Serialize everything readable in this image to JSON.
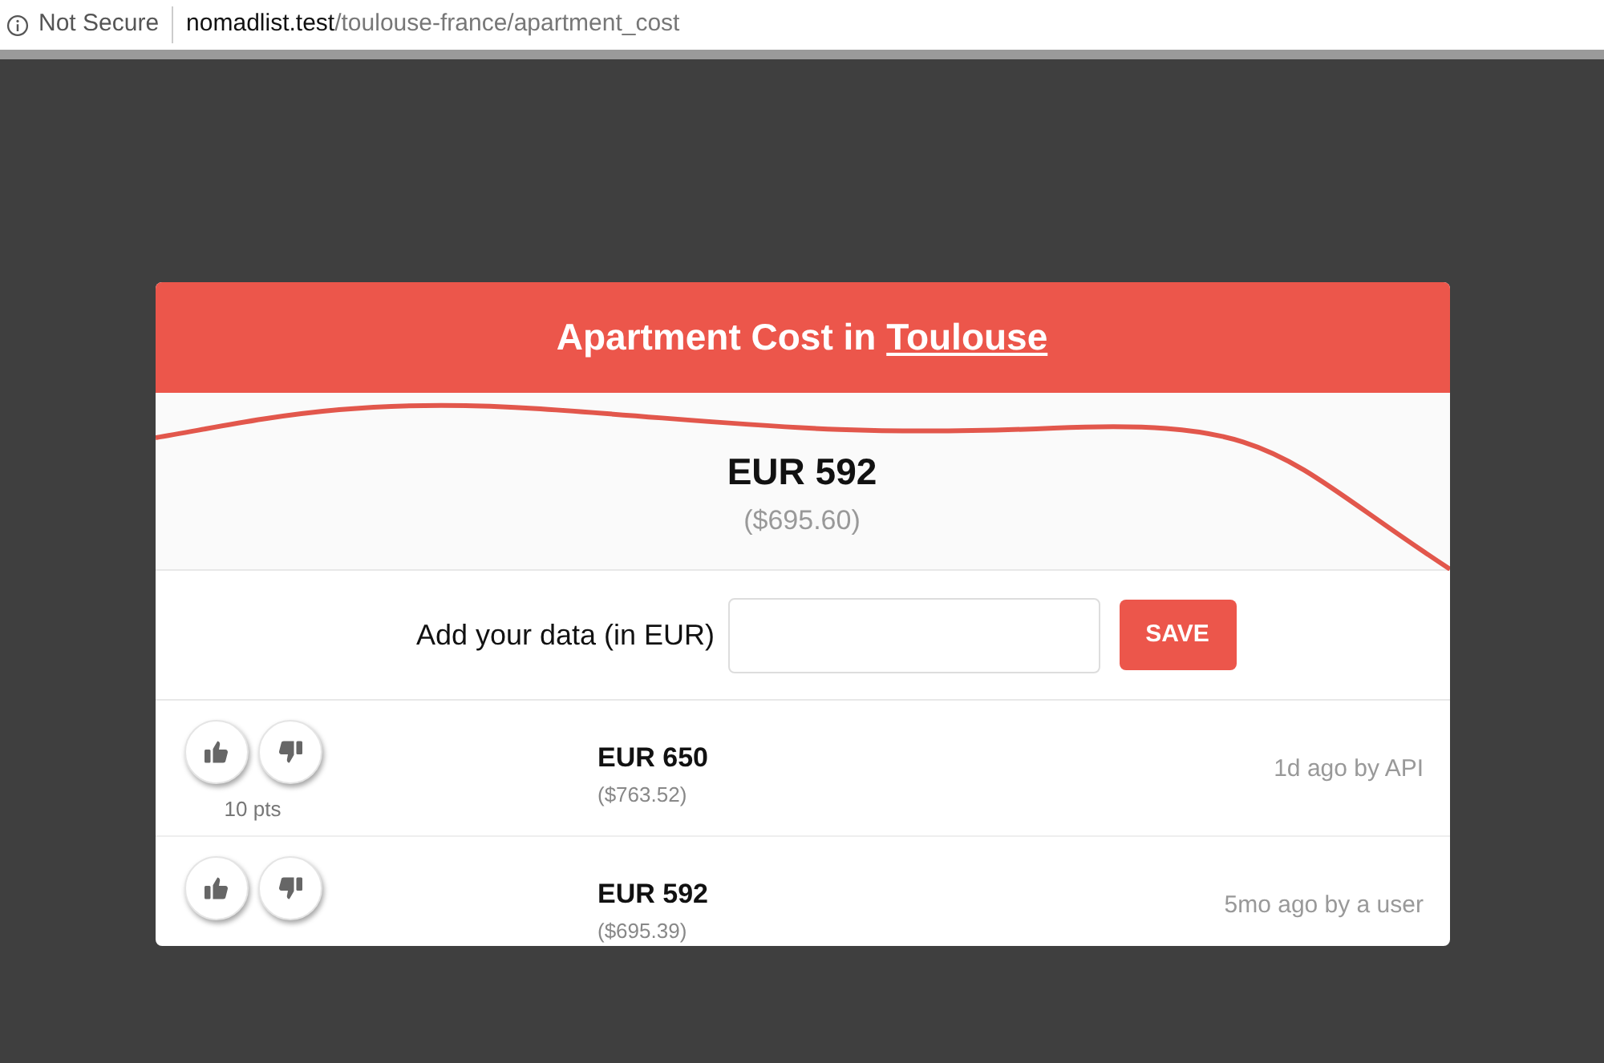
{
  "address_bar": {
    "security": "Not Secure",
    "domain": "nomadlist.test",
    "path": "/toulouse-france/apartment_cost"
  },
  "card": {
    "title": "Apartment Cost in",
    "city": "Toulouse",
    "price": "EUR 592",
    "price_usd": "($695.60)",
    "form": {
      "label": "Add your data (in EUR)",
      "button": "SAVE"
    },
    "entries": [
      {
        "points": "10 pts",
        "price": "EUR 650",
        "price_usd": "($763.52)",
        "source": "1d ago by API"
      },
      {
        "price": "EUR 592",
        "price_usd": "($695.39)",
        "source": "5mo ago by a user"
      }
    ]
  }
}
